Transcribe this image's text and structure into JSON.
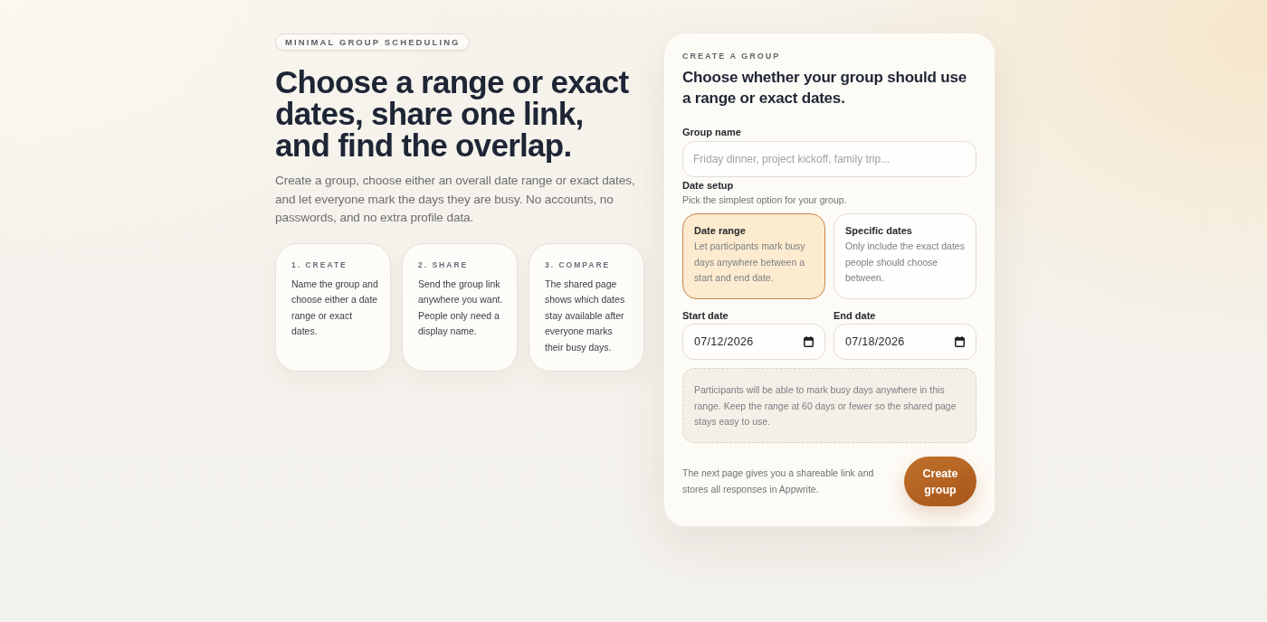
{
  "badge": "MINIMAL GROUP SCHEDULING",
  "hero": {
    "heading": "Choose a range or exact dates, share one link, and find the overlap.",
    "intro": "Create a group, choose either an overall date range or exact dates, and let everyone mark the days they are busy. No accounts, no passwords, and no extra profile data."
  },
  "steps": [
    {
      "label": "1. CREATE",
      "text": "Name the group and choose either a date range or exact dates."
    },
    {
      "label": "2. SHARE",
      "text": "Send the group link anywhere you want. People only need a display name."
    },
    {
      "label": "3. COMPARE",
      "text": "The shared page shows which dates stay available after everyone marks their busy days."
    }
  ],
  "form": {
    "eyebrow": "CREATE A GROUP",
    "title": "Choose whether your group should use a range or exact dates.",
    "group_name": {
      "label": "Group name",
      "placeholder": "Friday dinner, project kickoff, family trip..."
    },
    "date_setup": {
      "label": "Date setup",
      "hint": "Pick the simplest option for your group.",
      "options": [
        {
          "title": "Date range",
          "description": "Let participants mark busy days anywhere between a start and end date.",
          "selected": true
        },
        {
          "title": "Specific dates",
          "description": "Only include the exact dates people should choose between.",
          "selected": false
        }
      ]
    },
    "dates": [
      {
        "label": "Start date",
        "value": "07/12/2026"
      },
      {
        "label": "End date",
        "value": "07/18/2026"
      }
    ],
    "note": "Participants will be able to mark busy days anywhere in this range. Keep the range at 60 days or fewer so the shared page stays easy to use.",
    "footer_text": "The next page gives you a shareable link and stores all responses in Appwrite.",
    "submit": "Create group"
  }
}
